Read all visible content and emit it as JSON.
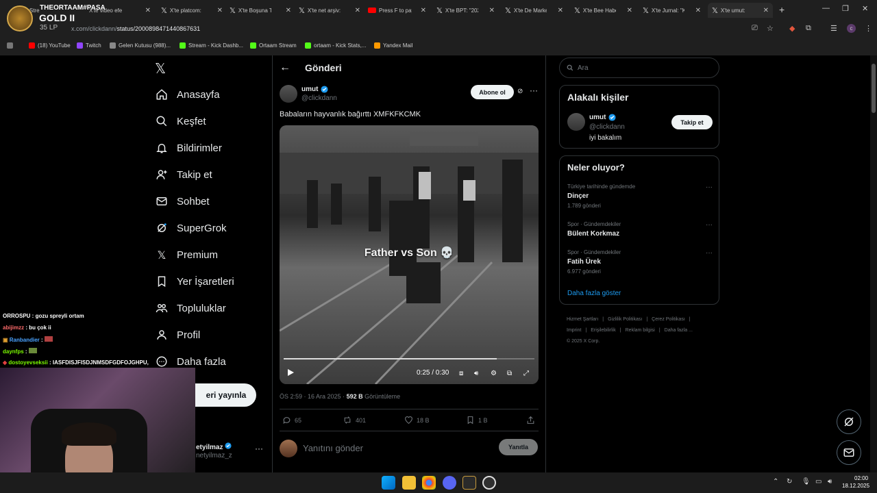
{
  "browser": {
    "tabs": [
      {
        "label": "Stre",
        "icon": "x"
      },
      {
        "label": "X'te video efe",
        "icon": "x"
      },
      {
        "label": "X'te platcom: '",
        "icon": "x"
      },
      {
        "label": "X'te Boşuna Ti",
        "icon": "x"
      },
      {
        "label": "X'te net arşiv: '",
        "icon": "x"
      },
      {
        "label": "Press F to pay",
        "icon": "youtube"
      },
      {
        "label": "X'te BPT: \"2025",
        "icon": "x"
      },
      {
        "label": "X'te De Marke",
        "icon": "x"
      },
      {
        "label": "X'te Bee Haber",
        "icon": "x"
      },
      {
        "label": "X'te Jurnal: \"Ka",
        "icon": "x"
      },
      {
        "label": "X'te umut:",
        "icon": "x"
      }
    ],
    "url_prefix": "x.com/clickdann/",
    "url_rest": "status/2000898471440867631",
    "bookmarks": [
      {
        "label": "(18) YouTube",
        "color": "#ff0000"
      },
      {
        "label": "Twitch",
        "color": "#9146ff"
      },
      {
        "label": "Gelen Kutusu (988)...",
        "color": "#888888"
      },
      {
        "label": "Stream - Kick Dashb...",
        "color": "#53fc18"
      },
      {
        "label": "Ortaam Stream",
        "color": "#53fc18"
      },
      {
        "label": "ortaam - Kick Stats,...",
        "color": "#53fc18"
      },
      {
        "label": "Yandex Mail",
        "color": "#ff9900"
      }
    ]
  },
  "overlay": {
    "name": "THEORTAAM#PASA",
    "rank": "GOLD II",
    "lp": "35 LP"
  },
  "nav": {
    "items": [
      {
        "label": "Anasayfa",
        "icon": "home-icon"
      },
      {
        "label": "Keşfet",
        "icon": "search-icon"
      },
      {
        "label": "Bildirimler",
        "icon": "bell-icon"
      },
      {
        "label": "Takip et",
        "icon": "person-add-icon"
      },
      {
        "label": "Sohbet",
        "icon": "mail-icon"
      },
      {
        "label": "SuperGrok",
        "icon": "grok-icon"
      },
      {
        "label": "Premium",
        "icon": "x-icon"
      },
      {
        "label": "Yer İşaretleri",
        "icon": "bookmark-icon"
      },
      {
        "label": "Topluluklar",
        "icon": "people-icon"
      },
      {
        "label": "Profil",
        "icon": "person-icon"
      },
      {
        "label": "Daha fazla",
        "icon": "more-icon"
      }
    ],
    "post_button": "eri yayınla",
    "profile_name": "etyilmaz",
    "profile_handle": "netyilmaz_z"
  },
  "post": {
    "header_title": "Gönderi",
    "author_name": "umut",
    "author_handle": "@clickdann",
    "follow_label": "Abone ol",
    "text": "Babaların hayvanlık bağırttı XMFKFKCMK",
    "video_caption": "Father vs Son 💀",
    "video_time": "0:25 / 0:30",
    "video_progress": 0.85,
    "meta_time": "ÖS 2:59 · 16 Ara 2025 · ",
    "meta_views": "592 B",
    "meta_views_label": " Görüntüleme",
    "replies": "65",
    "reposts": "401",
    "likes": "18 B",
    "bookmarks": "1 B",
    "reply_placeholder": "Yanıtını gönder",
    "reply_button": "Yanıtla"
  },
  "sidebar": {
    "search_placeholder": "Ara",
    "related_title": "Alakalı kişiler",
    "related_name": "umut",
    "related_handle": "@clickdann",
    "related_bio": "iyi bakalım",
    "related_follow": "Takip et",
    "trends_title": "Neler oluyor?",
    "trends": [
      {
        "context": "Türkiye tarihinde gündemde",
        "name": "Dinçer",
        "count": "1.789 gönderi"
      },
      {
        "context": "Spor · Gündemdekiler",
        "name": "Bülent Korkmaz",
        "count": ""
      },
      {
        "context": "Spor · Gündemdekiler",
        "name": "Fatih Ürek",
        "count": "6.977 gönderi"
      }
    ],
    "show_more": "Daha fazla göster",
    "footer": [
      "Hizmet Şartları",
      "|",
      "Gizlilik Politikası",
      "|",
      "Çerez Politikası",
      "|",
      "Imprint",
      "|",
      "Erişilebilirlik",
      "|",
      "Reklam bilgisi",
      "|",
      "Daha fazla ...",
      "© 2025 X Corp."
    ]
  },
  "chat": [
    {
      "user": "ORROSPU",
      "color": "#ffffff",
      "msg": " : gozu spreyli ortam"
    },
    {
      "user": "abijimzz",
      "color": "#ff6b6b",
      "msg": " : bu çok ii"
    },
    {
      "user": "Ranbandier",
      "color": "#4aa3ff",
      "msg": " : "
    },
    {
      "user": "daynfps",
      "color": "#7cfc00",
      "msg": " : "
    },
    {
      "user": "dostoyevseksii",
      "color": "#7cfc00",
      "msg": " : IASFDISJFISDJNMSDFGDFOJGHPU,"
    }
  ],
  "taskbar": {
    "time": "02:00",
    "date": "18.12.2025"
  }
}
